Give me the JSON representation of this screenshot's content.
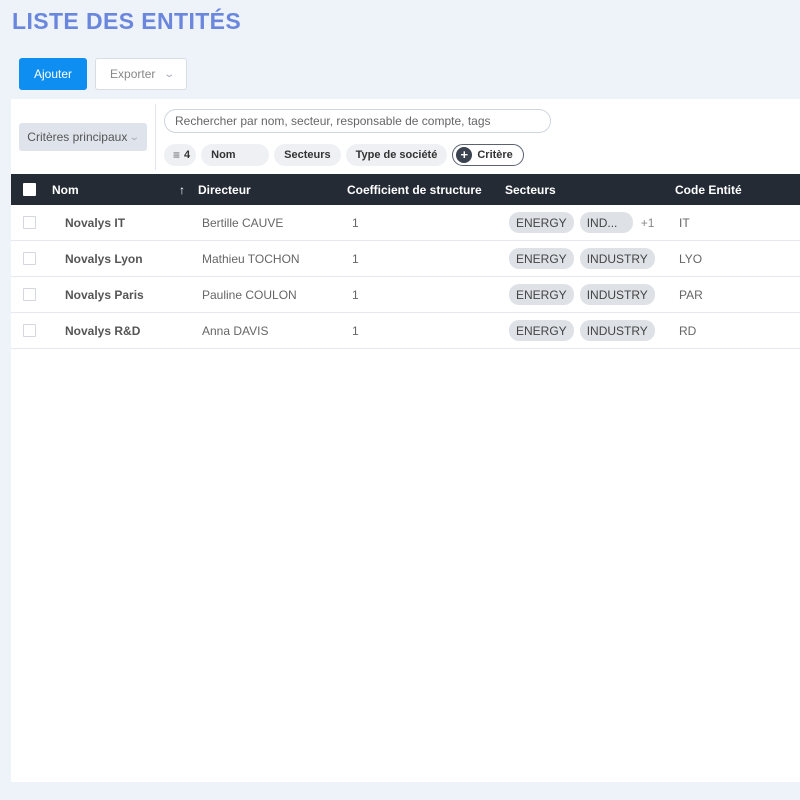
{
  "page": {
    "title": "LISTE DES ENTITÉS"
  },
  "toolbar": {
    "add_label": "Ajouter",
    "export_label": "Exporter"
  },
  "filters": {
    "criteria_label": "Critères principaux",
    "search_placeholder": "Rechercher par nom, secteur, responsable de compte, tags",
    "filter_count": "4",
    "chips": [
      "Nom",
      "Secteurs",
      "Type de société"
    ],
    "add_criteria_label": "Critère"
  },
  "table": {
    "columns": {
      "nom": "Nom",
      "sort_indicator": "↑",
      "directeur": "Directeur",
      "coefficient": "Coefficient de structure",
      "secteurs": "Secteurs",
      "code": "Code Entité"
    },
    "rows": [
      {
        "nom": "Novalys IT",
        "directeur": "Bertille CAUVE",
        "coefficient": "1",
        "tags": [
          "ENERGY",
          "IND..."
        ],
        "more": "+1",
        "code": "IT"
      },
      {
        "nom": "Novalys Lyon",
        "directeur": "Mathieu TOCHON",
        "coefficient": "1",
        "tags": [
          "ENERGY",
          "INDUSTRY"
        ],
        "code": "LYO"
      },
      {
        "nom": "Novalys Paris",
        "directeur": "Pauline COULON",
        "coefficient": "1",
        "tags": [
          "ENERGY",
          "INDUSTRY"
        ],
        "code": "PAR"
      },
      {
        "nom": "Novalys R&D",
        "directeur": "Anna DAVIS",
        "coefficient": "1",
        "tags": [
          "ENERGY",
          "INDUSTRY"
        ],
        "code": "RD"
      }
    ]
  },
  "colors": {
    "title": "#6a86dd",
    "primary": "#0d8ef0",
    "header_bg": "#252b35",
    "page_bg": "#eef2f9"
  }
}
